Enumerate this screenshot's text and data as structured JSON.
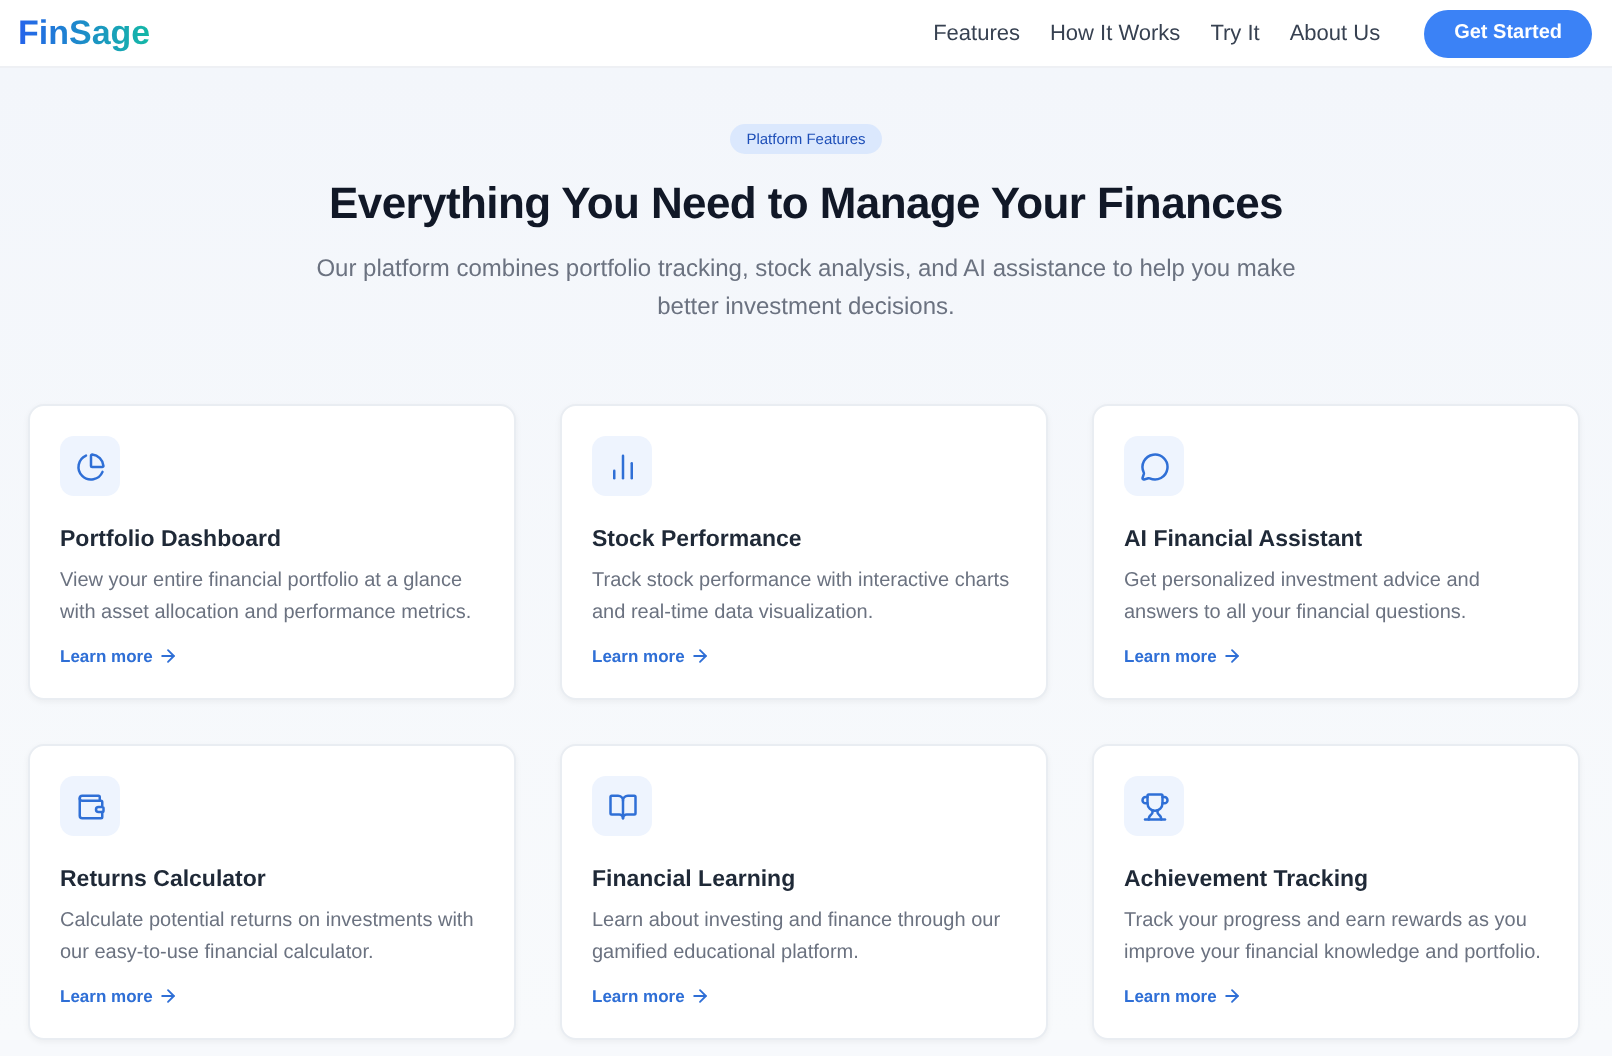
{
  "header": {
    "logo": "FinSage",
    "nav": [
      "Features",
      "How It Works",
      "Try It",
      "About Us"
    ],
    "cta": "Get Started"
  },
  "hero": {
    "badge": "Platform Features",
    "title": "Everything You Need to Manage Your Finances",
    "subtitle": "Our platform combines portfolio tracking, stock analysis, and AI assistance to help you make better investment decisions."
  },
  "features": [
    {
      "kind": "pie",
      "title": "Portfolio Dashboard",
      "description": "View your entire financial portfolio at a glance with asset allocation and performance metrics.",
      "link": "Learn more"
    },
    {
      "kind": "bars",
      "title": "Stock Performance",
      "description": "Track stock performance with interactive charts and real-time data visualization.",
      "link": "Learn more"
    },
    {
      "kind": "chat",
      "title": "AI Financial Assistant",
      "description": "Get personalized investment advice and answers to all your financial questions.",
      "link": "Learn more"
    },
    {
      "kind": "wallet",
      "title": "Returns Calculator",
      "description": "Calculate potential returns on investments with our easy-to-use financial calculator.",
      "link": "Learn more"
    },
    {
      "kind": "book",
      "title": "Financial Learning",
      "description": "Learn about investing and finance through our gamified educational platform.",
      "link": "Learn more"
    },
    {
      "kind": "trophy",
      "title": "Achievement Tracking",
      "description": "Track your progress and earn rewards as you improve your financial knowledge and portfolio.",
      "link": "Learn more"
    }
  ]
}
